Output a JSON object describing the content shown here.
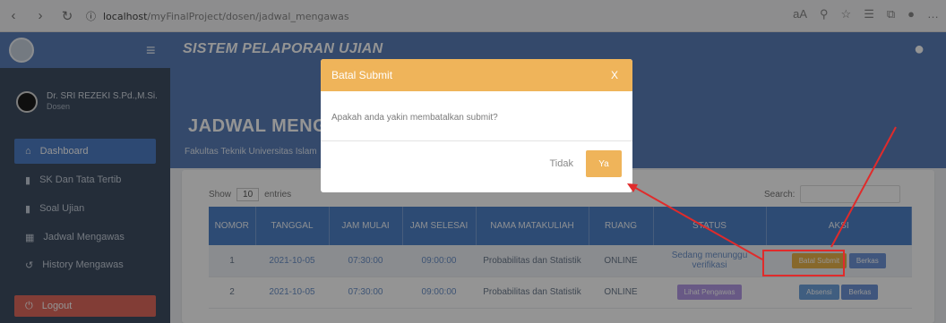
{
  "browser": {
    "url_host": "localhost",
    "url_path": "/myFinalProject/dosen/jadwal_mengawas",
    "zoom": "aA"
  },
  "app": {
    "title": "SISTEM PELAPORAN UJIAN"
  },
  "user": {
    "name": "Dr. SRI REZEKI S.Pd.,M.Si.",
    "role": "Dosen"
  },
  "sidebar": {
    "items": [
      {
        "label": "Dashboard"
      },
      {
        "label": "SK Dan Tata Tertib"
      },
      {
        "label": "Soal Ujian"
      },
      {
        "label": "Jadwal Mengawas"
      },
      {
        "label": "History Mengawas"
      },
      {
        "label": "Logout"
      }
    ]
  },
  "header": {
    "title": "JADWAL MENGA",
    "subtitle": "Fakultas Teknik Universitas Islam"
  },
  "table": {
    "show_label": "Show",
    "show_value": "10",
    "entries_label": "entries",
    "search_label": "Search:",
    "headers": [
      "NOMOR",
      "TANGGAL",
      "JAM MULAI",
      "JAM SELESAI",
      "NAMA MATAKULIAH",
      "RUANG",
      "STATUS",
      "AKSI"
    ],
    "rows": [
      {
        "no": "1",
        "tanggal": "2021-10-05",
        "mulai": "07:30:00",
        "selesai": "09:00:00",
        "mk": "Probabilitas dan Statistik",
        "ruang": "ONLINE",
        "status": "Sedang menunggu verifikasi",
        "aksi1": "Batal Submit",
        "aksi2": "Berkas"
      },
      {
        "no": "2",
        "tanggal": "2021-10-05",
        "mulai": "07:30:00",
        "selesai": "09:00:00",
        "mk": "Probabilitas dan Statistik",
        "ruang": "ONLINE",
        "status": "Lihat Pengawas",
        "aksi1": "Absensi",
        "aksi2": "Berkas"
      }
    ]
  },
  "modal": {
    "title": "Batal Submit",
    "close": "X",
    "message": "Apakah anda yakin membatalkan submit?",
    "cancel_label": "Tidak",
    "confirm_label": "Ya"
  }
}
